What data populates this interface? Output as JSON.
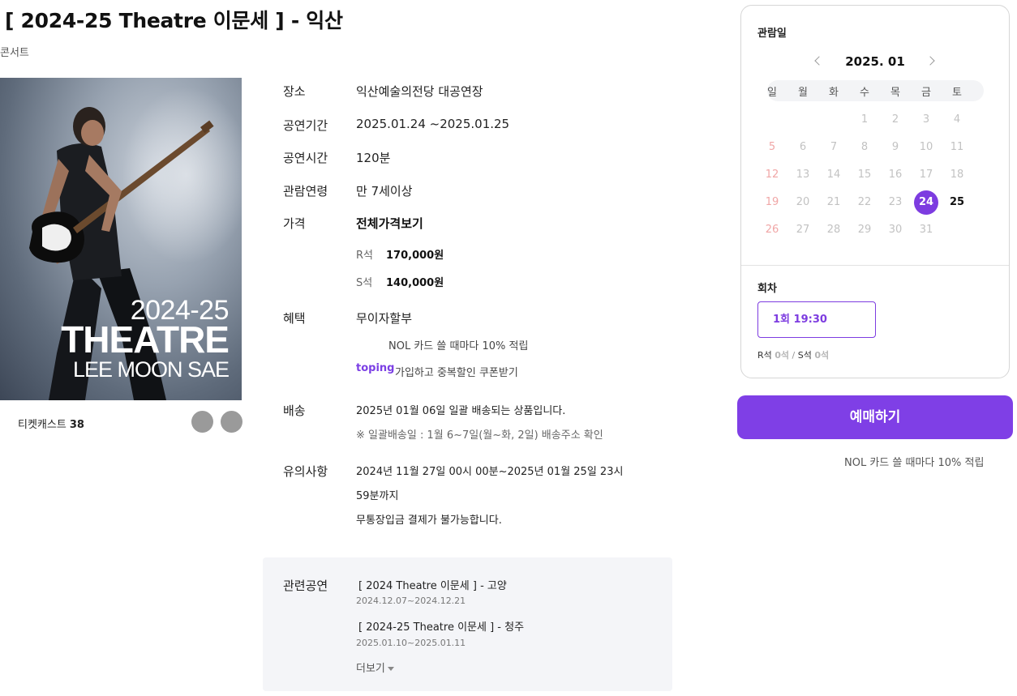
{
  "title": "[ 2024-25 Theatre 이문세 ]  - 익산",
  "genre": "콘서트",
  "poster": {
    "year": "2024-25",
    "theatre": "THEATRE",
    "name": "LEE MOON SAE"
  },
  "cast": {
    "label": "티켓캐스트",
    "count": "38"
  },
  "info": {
    "venue_label": "장소",
    "venue": "익산예술의전당 대공연장",
    "period_label": "공연기간",
    "period": "2025.01.24 ~2025.01.25",
    "runtime_label": "공연시간",
    "runtime": "120분",
    "age_label": "관람연령",
    "age": "만 7세이상",
    "price_label": "가격",
    "price_all": "전체가격보기",
    "prices": [
      {
        "seat": "R석",
        "price": "170,000원"
      },
      {
        "seat": "S석",
        "price": "140,000원"
      }
    ],
    "benefit_label": "혜택",
    "benefit": "무이자할부",
    "benefit_card": "NOL 카드 쓸 때마다 10% 적립",
    "toping_brand": "toping",
    "toping_text": "가입하고 중복할인 쿠폰받기",
    "delivery_label": "배송",
    "delivery": "2025년 01월 06일 일괄 배송되는 상품입니다.",
    "delivery_note": "※ 일괄배송일 : 1월 6~7일(월~화, 2일) 배송주소 확인",
    "notice_label": "유의사항",
    "notice_line1": "2024년 11월 27일 00시 00분~2025년 01월 25일 23시",
    "notice_line2": "59분까지",
    "notice_line3": "무통장입금 결제가 불가능합니다."
  },
  "related": {
    "label": "관련공연",
    "items": [
      {
        "title": "[ 2024 Theatre 이문세 ]  - 고양",
        "date": "2024.12.07~2024.12.21"
      },
      {
        "title": "[ 2024-25 Theatre 이문세 ]  - 청주",
        "date": "2025.01.10~2025.01.11"
      }
    ],
    "more": "더보기"
  },
  "booking": {
    "date_heading": "관람일",
    "month": "2025. 01",
    "weekdays": [
      "일",
      "월",
      "화",
      "수",
      "목",
      "금",
      "토"
    ],
    "weeks": [
      [
        "",
        "",
        "",
        "1",
        "2",
        "3",
        "4"
      ],
      [
        "5",
        "6",
        "7",
        "8",
        "9",
        "10",
        "11"
      ],
      [
        "12",
        "13",
        "14",
        "15",
        "16",
        "17",
        "18"
      ],
      [
        "19",
        "20",
        "21",
        "22",
        "23",
        "24",
        "25"
      ],
      [
        "26",
        "27",
        "28",
        "29",
        "30",
        "31",
        ""
      ]
    ],
    "selected_day": "24",
    "available_days": [
      "24",
      "25"
    ],
    "session_heading": "회차",
    "session": "1회  19:30",
    "remaining": [
      {
        "seat": "R석",
        "count": "0석"
      },
      {
        "seat": "S석",
        "count": "0석"
      }
    ],
    "book_button": "예매하기",
    "book_note": "NOL 카드 쓸 때마다 10% 적립",
    "accent_color": "#7f3fe6"
  }
}
